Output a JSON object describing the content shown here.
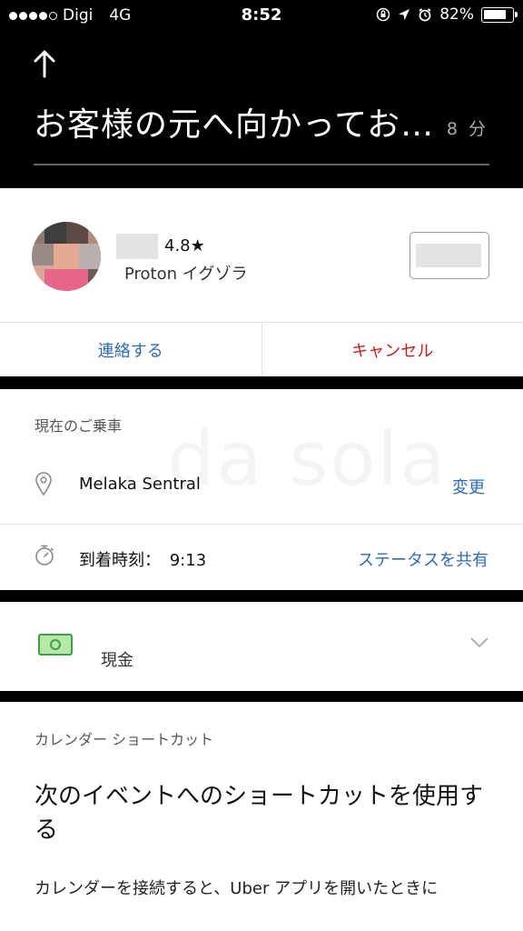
{
  "status_bar": {
    "carrier": "Digi",
    "network": "4G",
    "time": "8:52",
    "battery": "82%",
    "battery_level": 0.82
  },
  "header": {
    "destination_status": "お客様の元へ向かってお…",
    "eta": "8 分"
  },
  "driver": {
    "rating": "4.8★",
    "car": "Proton イグゾラ"
  },
  "actions": {
    "contact": "連絡する",
    "cancel": "キャンセル"
  },
  "trip": {
    "section_label": "現在のご乗車",
    "watermark": "...da sola",
    "destination": "Melaka Sentral",
    "change_link": "変更",
    "arrival_label": "到着時刻：",
    "arrival_time": "9:13",
    "share_link": "ステータスを共有"
  },
  "payment": {
    "method": "現金"
  },
  "calendar": {
    "section_label": "カレンダー ショートカット",
    "heading": "次のイベントへのショートカットを使用する",
    "body": "カレンダーを接続すると、Uber アプリを開いたときに"
  },
  "colors": {
    "link_blue": "#2f6bb7",
    "cancel_red": "#c32020",
    "cash_green": "#3aa04a"
  },
  "icons": [
    "back-arrow-icon",
    "location-pin-icon",
    "stopwatch-icon",
    "cash-icon",
    "chevron-down-icon",
    "lock-rotation-icon",
    "location-arrow-icon",
    "alarm-icon",
    "battery-icon"
  ]
}
